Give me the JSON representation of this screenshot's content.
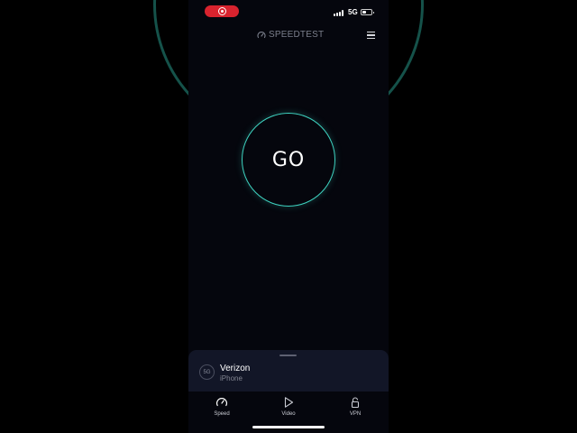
{
  "status_bar": {
    "network": "5G",
    "battery_level": 0.45,
    "recording_color": "#d9232e"
  },
  "header": {
    "logo_text": "SPEEDTEST",
    "logo_icon": "gauge-icon",
    "menu_icon": "hamburger-menu-icon"
  },
  "go_button": {
    "label": "GO",
    "accent": "#3ed3c1"
  },
  "connection": {
    "badge": "5G",
    "provider": "Verizon",
    "device": "iPhone"
  },
  "tabs": [
    {
      "label": "Speed",
      "icon": "speedometer-icon"
    },
    {
      "label": "Video",
      "icon": "play-icon"
    },
    {
      "label": "VPN",
      "icon": "lock-icon"
    }
  ],
  "colors": {
    "background": "#05060d",
    "sheet": "#121627",
    "ring_bg": "#15524a"
  }
}
